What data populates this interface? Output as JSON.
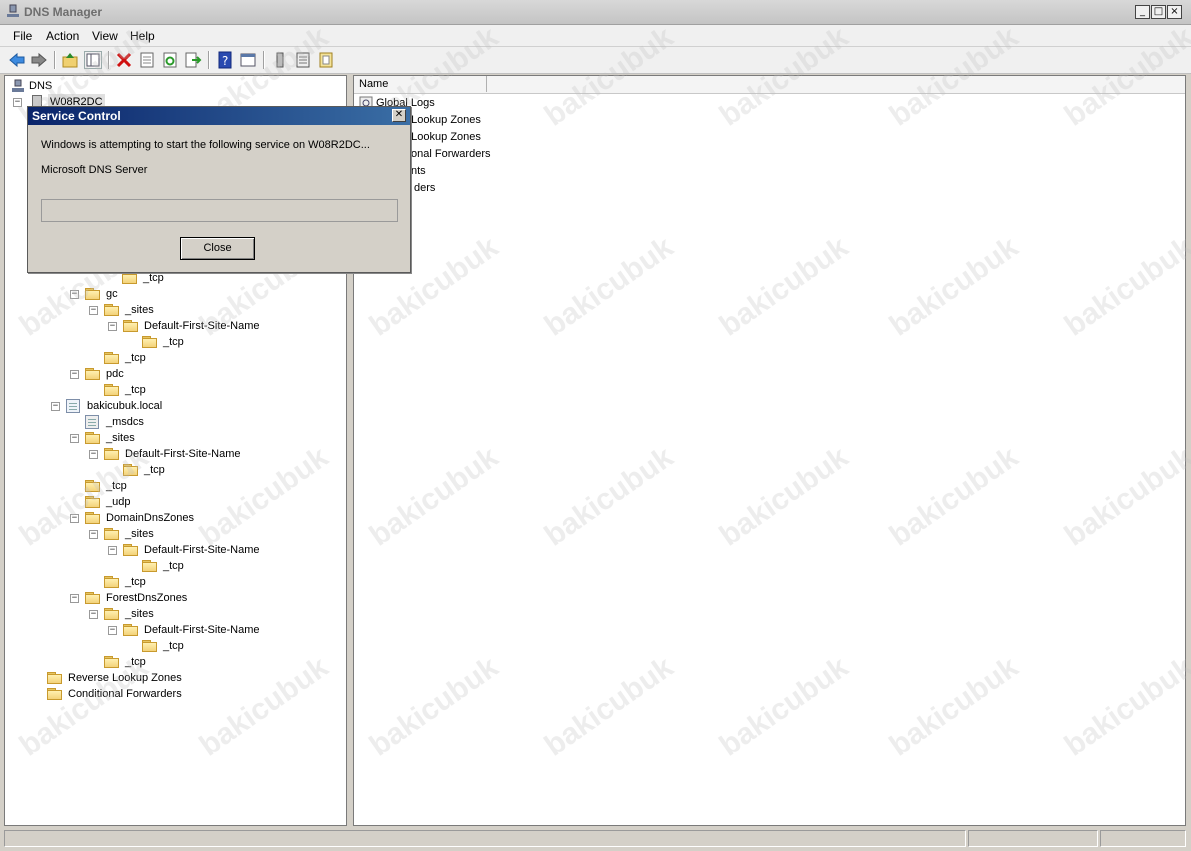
{
  "window": {
    "title": "DNS Manager"
  },
  "menu": [
    "File",
    "Action",
    "View",
    "Help"
  ],
  "toolbar": [
    "back-icon",
    "forward-icon",
    "up-icon",
    "show-hide-tree-icon",
    "delete-icon",
    "properties-icon",
    "refresh-icon",
    "export-icon",
    "help-icon",
    "console-icon",
    "server-icon",
    "list-icon",
    "zone-icon"
  ],
  "tree": {
    "root": "DNS",
    "server": "W08R2DC",
    "items": [
      {
        "label": "_tcp"
      },
      {
        "label": "gc"
      },
      {
        "label": "_sites"
      },
      {
        "label": "Default-First-Site-Name"
      },
      {
        "label": "_tcp"
      },
      {
        "label": "_tcp"
      },
      {
        "label": "pdc"
      },
      {
        "label": "_tcp"
      },
      {
        "label": "bakicubuk.local"
      },
      {
        "label": "_msdcs"
      },
      {
        "label": "_sites"
      },
      {
        "label": "Default-First-Site-Name"
      },
      {
        "label": "_tcp"
      },
      {
        "label": "_tcp"
      },
      {
        "label": "_udp"
      },
      {
        "label": "DomainDnsZones"
      },
      {
        "label": "_sites"
      },
      {
        "label": "Default-First-Site-Name"
      },
      {
        "label": "_tcp"
      },
      {
        "label": "_tcp"
      },
      {
        "label": "ForestDnsZones"
      },
      {
        "label": "_sites"
      },
      {
        "label": "Default-First-Site-Name"
      },
      {
        "label": "_tcp"
      },
      {
        "label": "_tcp"
      },
      {
        "label": "Reverse Lookup Zones"
      },
      {
        "label": "Conditional Forwarders"
      }
    ]
  },
  "list": {
    "column": "Name",
    "items": [
      "Global Logs",
      "d Lookup Zones",
      "e Lookup Zones",
      "onal Forwarders",
      "nts",
      "ders"
    ]
  },
  "dialog": {
    "title": "Service Control",
    "message": "Windows is attempting to start the following service on W08R2DC...",
    "service": "Microsoft DNS Server",
    "button": "Close"
  },
  "watermark": "bakicubuk"
}
